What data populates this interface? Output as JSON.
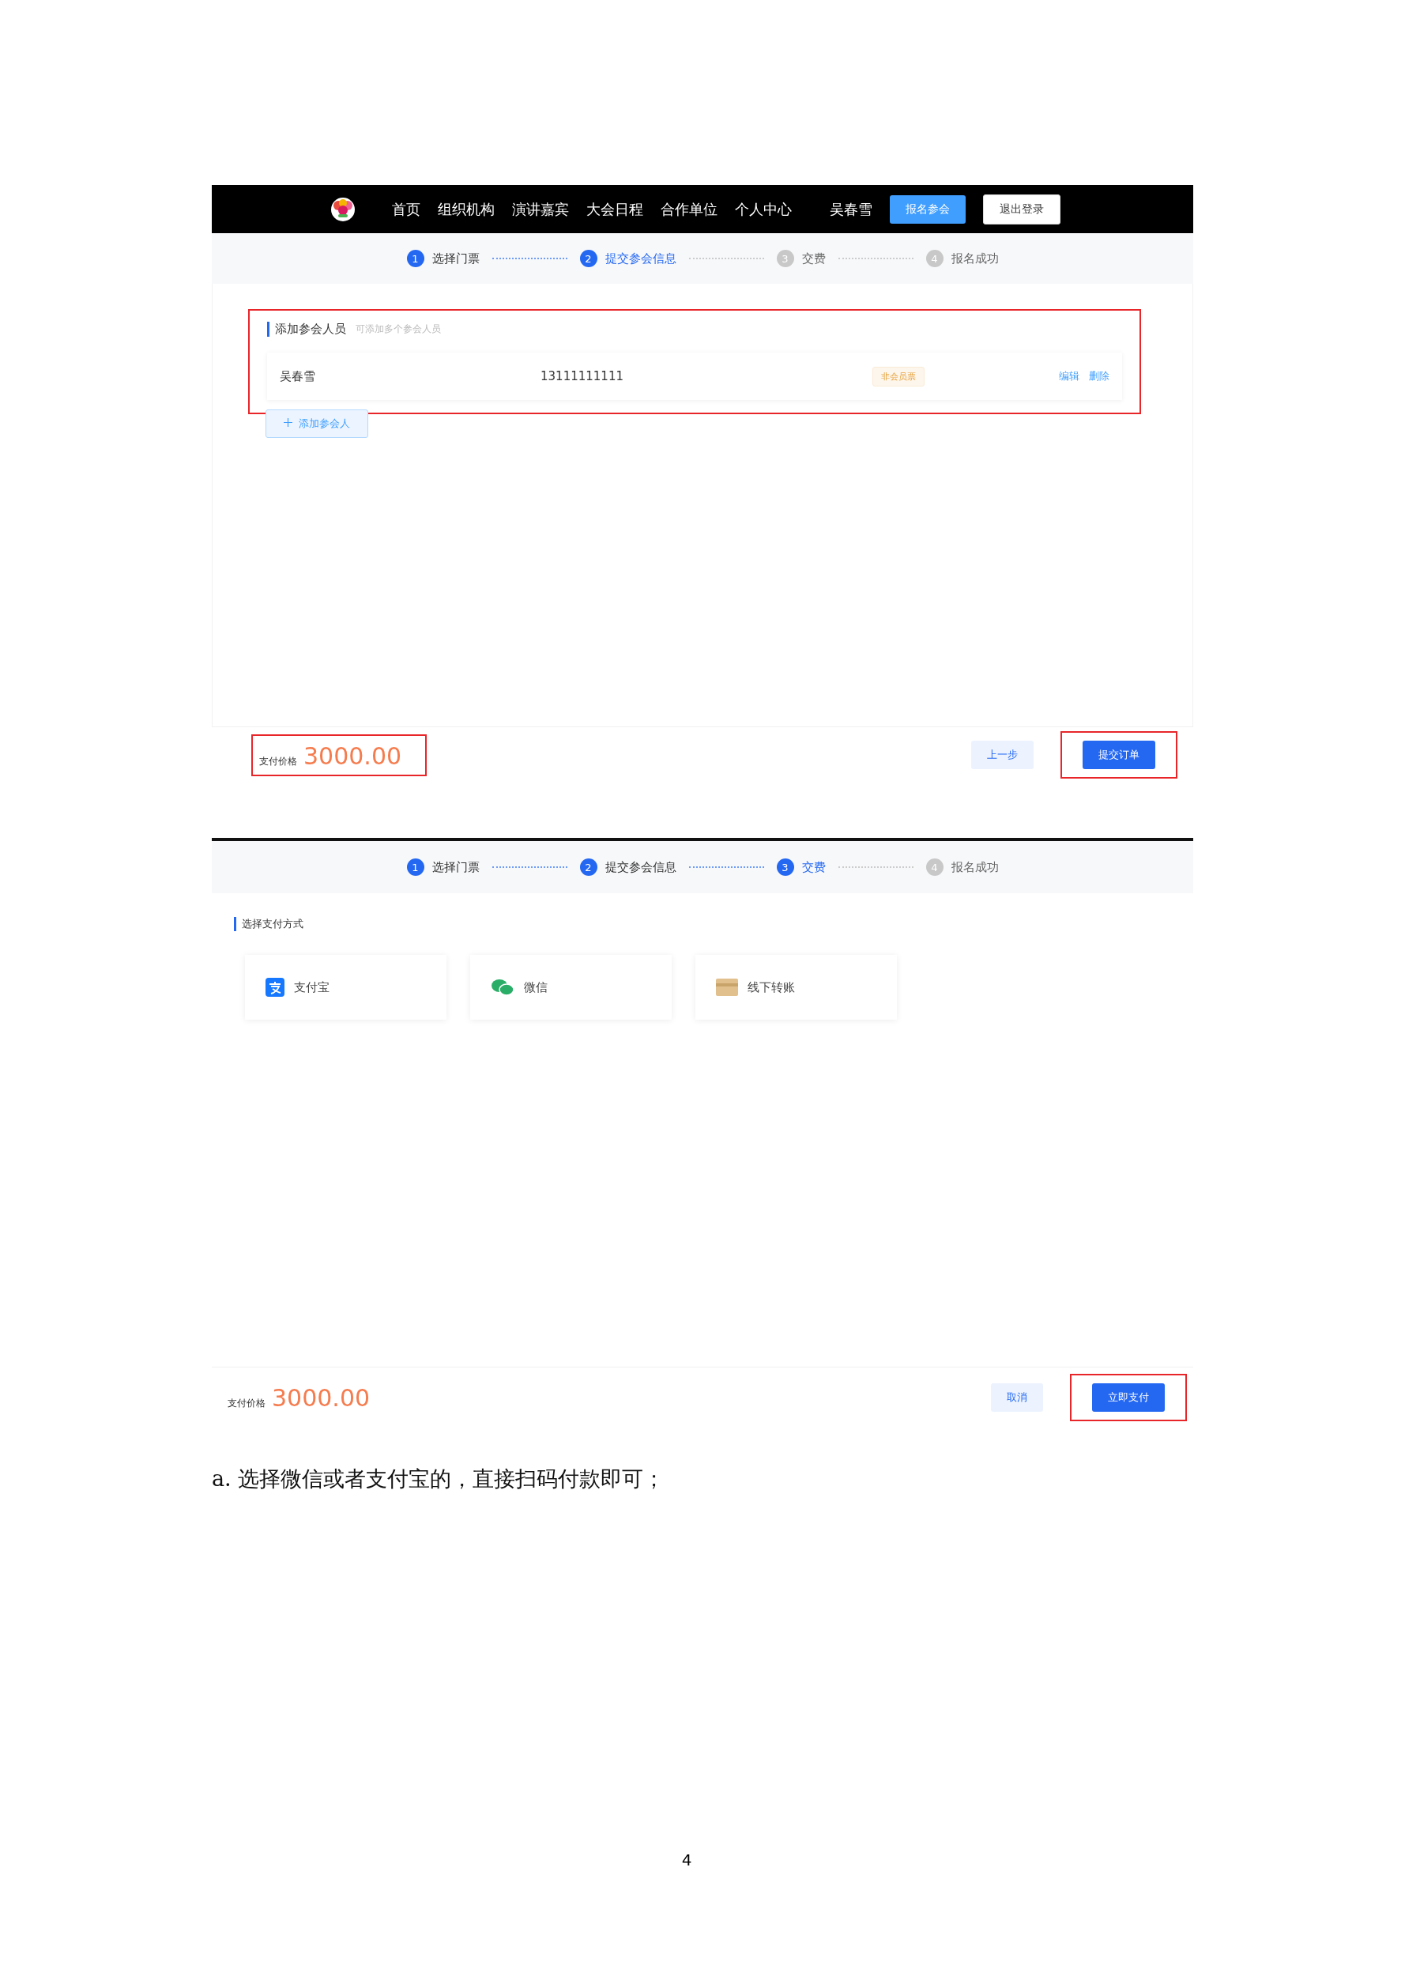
{
  "screenshot_1": {
    "nav": {
      "items": [
        "首页",
        "组织机构",
        "演讲嘉宾",
        "大会日程",
        "合作单位",
        "个人中心"
      ],
      "user": "吴春雪",
      "register_button": "报名参会",
      "logout_button": "退出登录"
    },
    "steps": [
      {
        "number": "1",
        "label": "选择门票",
        "selected": false
      },
      {
        "number": "2",
        "label": "提交参会信息",
        "selected": true
      },
      {
        "number": "3",
        "label": "交费",
        "selected": false
      },
      {
        "number": "4",
        "label": "报名成功",
        "selected": false
      }
    ],
    "participants": {
      "highlighted": true,
      "title": "添加参会人员",
      "hint": "可添加多个参会人员",
      "rows": [
        {
          "name": "吴春雪",
          "phone": "13111111111",
          "ticket": "非会员票",
          "actions": [
            "编辑",
            "删除"
          ]
        }
      ],
      "add_button": "添加参会人"
    },
    "footer": {
      "price_label": "支付价格",
      "price": "3000.00",
      "price_highlighted": true,
      "buttons": [
        {
          "label": "上一步",
          "kind": "secondary",
          "highlighted": false
        },
        {
          "label": "提交订单",
          "kind": "primary",
          "highlighted": true
        }
      ]
    }
  },
  "screenshot_2": {
    "steps": [
      {
        "number": "1",
        "label": "选择门票",
        "selected": false
      },
      {
        "number": "2",
        "label": "提交参会信息",
        "selected": false
      },
      {
        "number": "3",
        "label": "交费",
        "selected": true
      },
      {
        "number": "4",
        "label": "报名成功",
        "selected": false
      }
    ],
    "section_title": "选择支付方式",
    "payment_methods": [
      {
        "label": "支付宝",
        "kind": "alipay"
      },
      {
        "label": "微信",
        "kind": "wechat"
      },
      {
        "label": "线下转账",
        "kind": "transfer"
      }
    ],
    "footer": {
      "price_label": "支付价格",
      "price": "3000.00",
      "price_highlighted": false,
      "buttons": [
        {
          "label": "取消",
          "kind": "secondary",
          "highlighted": false
        },
        {
          "label": "立即支付",
          "kind": "primary",
          "highlighted": true
        }
      ]
    }
  },
  "caption": "a. 选择微信或者支付宝的，直接扫码付款即可；",
  "page_number": "4"
}
